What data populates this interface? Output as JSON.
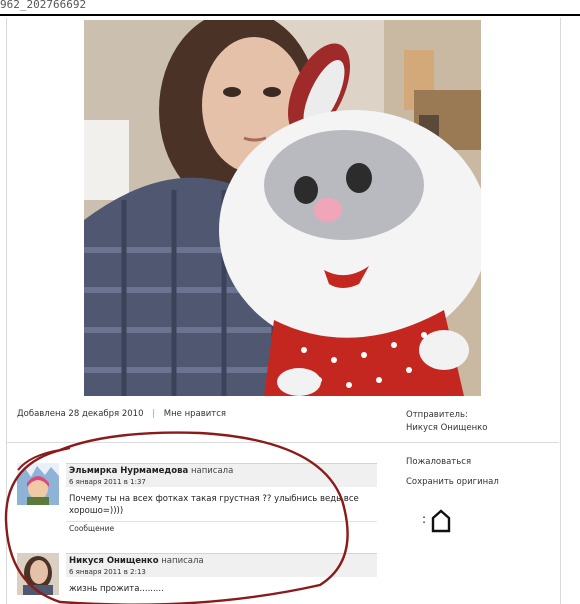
{
  "topbar": {
    "title": "962_202766692"
  },
  "photo": {
    "alt": "Фото"
  },
  "info": {
    "added": "Добавлена 28 декабря 2010",
    "separator": "|",
    "like": "Мне нравится"
  },
  "sender": {
    "label": "Отправитель:",
    "name": "Никуся Онищенко"
  },
  "actions": {
    "report": "Пожаловаться",
    "save": "Сохранить оригинал",
    "glyph": ":"
  },
  "comments": [
    {
      "author": "Эльмирка Нурмамедова",
      "wrote": "написала",
      "date": "6 января 2011 в 1:37",
      "text": "Почему ты на всех фотках такая грустная ?? улыбнись ведь все хорошо=))))",
      "link": "Сообщение"
    },
    {
      "author": "Никуся Онищенко",
      "wrote": "написала",
      "date": "6 января 2011 в 2:13",
      "text": "жизнь прожита.........",
      "link": ""
    }
  ],
  "colors": {
    "circle": "#8b1a1a",
    "plush_red": "#c4271f"
  }
}
